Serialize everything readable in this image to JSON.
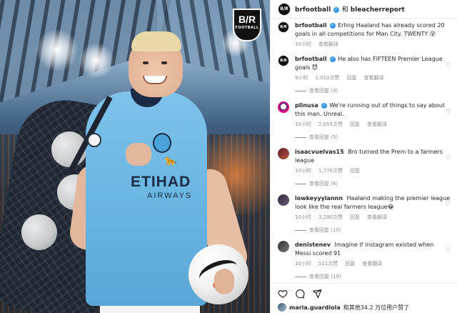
{
  "post": {
    "logo": {
      "text": "B/R",
      "subtext": "FOOTBALL"
    },
    "shirt_sponsor": "ETIHAD",
    "shirt_sponsor_sub": "AIRWAYS"
  },
  "header": {
    "account": "brfootball",
    "joiner": "和",
    "collaborator": "bleacherreport",
    "avatar_text": "B/R",
    "verified_icon": "verified-icon"
  },
  "comments": [
    {
      "username": "brfootball",
      "avatar": "B/R",
      "verified": true,
      "text": "Erling Haaland has already scored 20 goals in all competitions for Man City. TWENTY 😲",
      "time": "10小时",
      "likes": "",
      "reply": "",
      "translate": "查看翻译",
      "replies": ""
    },
    {
      "username": "brfootball",
      "avatar": "B/R",
      "verified": true,
      "text": "He also has FIFTEEN Premier League goals 😈",
      "time": "9小时",
      "likes": "1,010次赞",
      "reply": "回复",
      "translate": "查看翻译",
      "replies": "查看回复 (3)"
    },
    {
      "username": "plinusa",
      "avatar": "",
      "verified": true,
      "text": "We're running out of things to say about this man. Unreal.",
      "time": "10小时",
      "likes": "2,055次赞",
      "reply": "回复",
      "translate": "查看翻译",
      "replies": "查看回复 (5)"
    },
    {
      "username": "isaacvuelvas15",
      "avatar": "",
      "verified": false,
      "text": "Bro turned the Prem to a farmers league",
      "time": "10小时",
      "likes": "1,776次赞",
      "reply": "回复",
      "translate": "",
      "replies": "查看回复 (6)"
    },
    {
      "username": "lowkeyyyiannn",
      "avatar": "",
      "verified": false,
      "text": "Haaland making the premier league look like the real farmers league😂",
      "time": "10小时",
      "likes": "3,280次赞",
      "reply": "回复",
      "translate": "查看翻译",
      "replies": "查看回复 (10)"
    },
    {
      "username": "denistenev",
      "avatar": "",
      "verified": false,
      "text": "Imagine if instagram existed when Messi scored 91",
      "time": "10小时",
      "likes": "521次赞",
      "reply": "回复",
      "translate": "查看翻译",
      "replies": "查看回复 (19)"
    }
  ],
  "actions": {
    "like_icon": "heart-icon",
    "comment_icon": "comment-icon",
    "share_icon": "share-icon"
  },
  "likes_line": {
    "user": "maria.guardiola",
    "rest": "和其他34.2 万位用户赞了"
  }
}
